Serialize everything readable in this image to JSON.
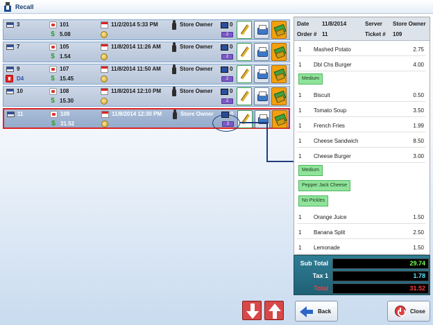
{
  "window": {
    "title": "Recall"
  },
  "orders": [
    {
      "table": "3",
      "guests": "101",
      "amount": "5.08",
      "datetime": "11/2/2014 5:33 PM",
      "server": "Store Owner",
      "count": "0",
      "extra_icon": ""
    },
    {
      "table": "7",
      "guests": "105",
      "amount": "1.54",
      "datetime": "11/8/2014 11:26 AM",
      "server": "Store Owner",
      "count": "0",
      "extra_icon": ""
    },
    {
      "table": "9",
      "guests": "107",
      "amount": "15.45",
      "datetime": "11/8/2014 11:50 AM",
      "server": "Store Owner",
      "count": "0",
      "extra_icon": "D4"
    },
    {
      "table": "10",
      "guests": "108",
      "amount": "15.30",
      "datetime": "11/8/2014 12:10 PM",
      "server": "Store Owner",
      "count": "0",
      "extra_icon": ""
    },
    {
      "table": "11",
      "guests": "109",
      "amount": "31.52",
      "datetime": "11/8/2014 12:30 PM",
      "server": "Store Owner",
      "count": "0",
      "extra_icon": "",
      "selected": true
    }
  ],
  "receipt": {
    "date_label": "Date",
    "date_value": "11/8/2014",
    "server_label": "Server",
    "server_value": "Store Owner",
    "order_label": "Order #",
    "order_value": "11",
    "ticket_label": "Ticket #",
    "ticket_value": "109",
    "items": [
      {
        "qty": "1",
        "name": "Mashed Potato",
        "price": "2.75",
        "mods": []
      },
      {
        "qty": "1",
        "name": "Dbl Chs Burger",
        "price": "4.00",
        "mods": [
          "Medium"
        ]
      },
      {
        "qty": "1",
        "name": "Biscuit",
        "price": "0.50",
        "mods": []
      },
      {
        "qty": "1",
        "name": "Tomato Soup",
        "price": "3.50",
        "mods": []
      },
      {
        "qty": "1",
        "name": "French Fries",
        "price": "1.99",
        "mods": []
      },
      {
        "qty": "1",
        "name": "Cheese Sandwich",
        "price": "8.50",
        "mods": []
      },
      {
        "qty": "1",
        "name": "Cheese Burger",
        "price": "3.00",
        "mods": [
          "Medium",
          "Pepper Jack Cheese",
          "No Pickles"
        ]
      },
      {
        "qty": "1",
        "name": "Orange Juice",
        "price": "1.50",
        "mods": []
      },
      {
        "qty": "1",
        "name": "Banana Split",
        "price": "2.50",
        "mods": []
      },
      {
        "qty": "1",
        "name": "Lemonade",
        "price": "1.50",
        "mods": []
      }
    ]
  },
  "totals": {
    "subtotal_label": "Sub Total",
    "subtotal_value": "29.74",
    "tax_label": "Tax 1",
    "tax_value": "1.78",
    "total_label": "Total",
    "total_value": "31.52"
  },
  "buttons": {
    "back_label": "Back",
    "close_label": "Close"
  },
  "colors": {
    "subtotal": "#7cff52",
    "tax": "#5ce6ff",
    "total": "#ff3b3b",
    "selected_border": "#e02222"
  }
}
